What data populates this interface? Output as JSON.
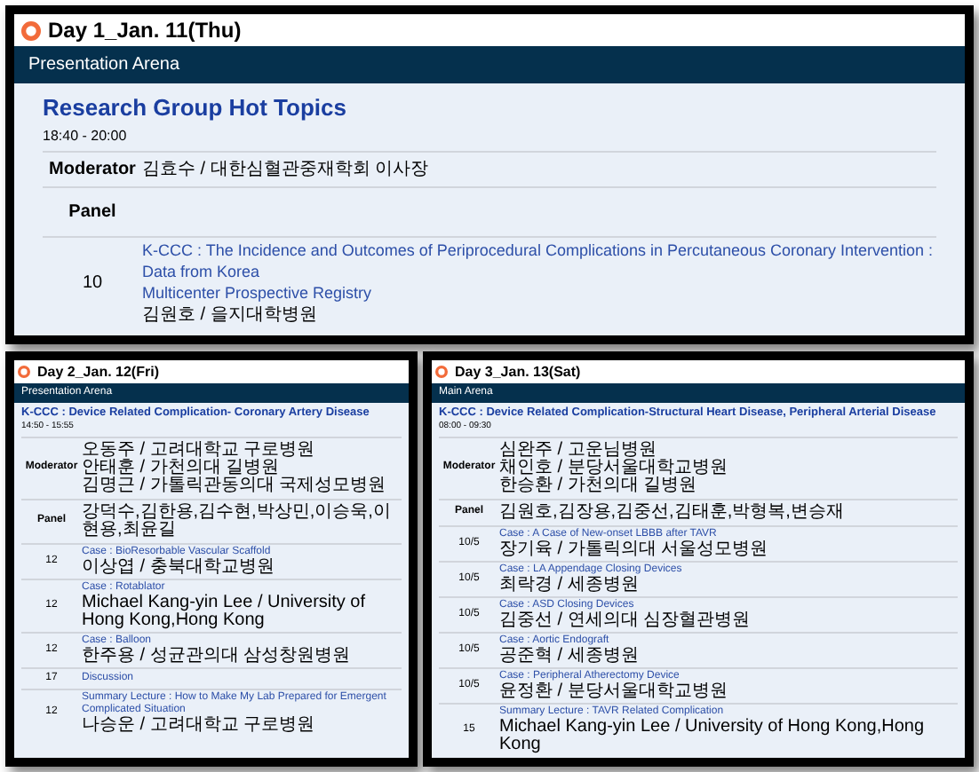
{
  "panels": [
    {
      "day": "Day 1_Jan. 11(Thu)",
      "arena": "Presentation Arena",
      "session_title": "Research Group Hot Topics",
      "time": "18:40 - 20:00",
      "moderator_label": "Moderator",
      "moderators": [
        "김효수 / 대한심혈관중재학회 이사장"
      ],
      "panel_label": "Panel",
      "talks": [
        {
          "duration": "10",
          "title_lines": [
            "K-CCC : The Incidence and Outcomes of Periprocedural Complications in Percutaneous Coronary Intervention : Data from Korea",
            "Multicenter Prospective Registry"
          ],
          "speaker": "김원호 / 을지대학병원"
        }
      ]
    },
    {
      "day": "Day 2_Jan. 12(Fri)",
      "arena": "Presentation Arena",
      "session_title": "K-CCC : Device Related Complication- Coronary Artery Disease",
      "time": "14:50 - 15:55",
      "moderator_label": "Moderator",
      "moderators": [
        "오동주 / 고려대학교 구로병원",
        "안태훈 / 가천의대 길병원",
        "김명근 / 가톨릭관동의대 국제성모병원"
      ],
      "panel_label": "Panel",
      "panelists": "강덕수,김한용,김수현,박상민,이승욱,이현용,최윤길",
      "talks": [
        {
          "duration": "12",
          "title_lines": [
            "Case : BioResorbable Vascular Scaffold"
          ],
          "speaker": "이상엽 / 충북대학교병원"
        },
        {
          "duration": "12",
          "title_lines": [
            "Case : Rotablator"
          ],
          "speaker": "Michael Kang-yin Lee / University of Hong Kong,Hong Kong"
        },
        {
          "duration": "12",
          "title_lines": [
            "Case : Balloon"
          ],
          "speaker": "한주용 / 성균관의대 삼성창원병원"
        },
        {
          "duration": "17",
          "title_lines": [
            "Discussion"
          ]
        },
        {
          "duration": "12",
          "title_lines": [
            "Summary Lecture : How to Make My Lab Prepared for Emergent Complicated Situation"
          ],
          "speaker": "나승운 / 고려대학교 구로병원"
        }
      ]
    },
    {
      "day": "Day 3_Jan. 13(Sat)",
      "arena": "Main Arena",
      "session_title": "K-CCC : Device Related Complication-Structural Heart Disease, Peripheral Arterial Disease",
      "time": "08:00 - 09:30",
      "moderator_label": "Moderator",
      "moderators": [
        "심완주 / 고운님병원",
        "채인호 / 분당서울대학교병원",
        "한승환 / 가천의대 길병원"
      ],
      "panel_label": "Panel",
      "panelists": "김원호,김장용,김중선,김태훈,박형복,변승재",
      "talks": [
        {
          "duration": "10/5",
          "title_lines": [
            "Case : A Case of New-onset LBBB after TAVR"
          ],
          "speaker": "장기육 / 가톨릭의대 서울성모병원"
        },
        {
          "duration": "10/5",
          "title_lines": [
            "Case : LA Appendage Closing Devices"
          ],
          "speaker": "최락경 / 세종병원"
        },
        {
          "duration": "10/5",
          "title_lines": [
            "Case : ASD Closing Devices"
          ],
          "speaker": "김중선 / 연세의대 심장혈관병원"
        },
        {
          "duration": "10/5",
          "title_lines": [
            "Case : Aortic Endograft"
          ],
          "speaker": "공준혁 / 세종병원"
        },
        {
          "duration": "10/5",
          "title_lines": [
            "Case : Peripheral Atherectomy Device"
          ],
          "speaker": "윤정환 / 분당서울대학교병원"
        },
        {
          "duration": "15",
          "title_lines": [
            "Summary Lecture : TAVR Related Complication"
          ],
          "speaker": "Michael Kang-yin Lee / University of Hong Kong,Hong Kong"
        }
      ]
    }
  ]
}
